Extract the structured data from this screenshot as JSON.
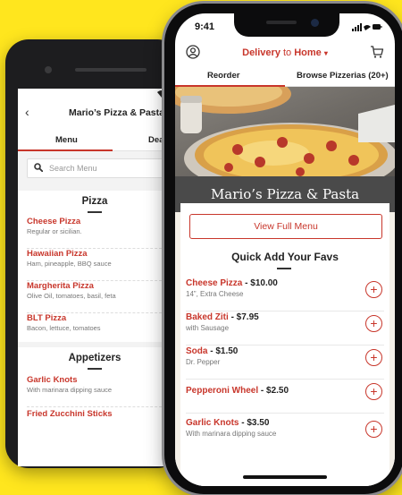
{
  "android": {
    "header": {
      "back_glyph": "‹",
      "title": "Mario’s Pizza & Pasta"
    },
    "tabs": [
      {
        "label": "Menu"
      },
      {
        "label": "Dea"
      }
    ],
    "search": {
      "placeholder": "Search Menu",
      "icon": "search-icon"
    },
    "sections": [
      {
        "title": "Pizza",
        "items": [
          {
            "name": "Cheese Pizza",
            "desc": "Regular or sicilian."
          },
          {
            "name": "Hawaiian Pizza",
            "desc": "Ham, pineapple, BBQ sauce"
          },
          {
            "name": "Margherita Pizza",
            "desc": "Olive Oil, tomatoes, basil, feta"
          },
          {
            "name": "BLT Pizza",
            "desc": "Bacon, lettuce, tomatoes"
          }
        ]
      },
      {
        "title": "Appetizers",
        "items": [
          {
            "name": "Garlic Knots",
            "desc": "With marinara dipping sauce"
          },
          {
            "name": "Fried Zucchini Sticks",
            "desc": ""
          }
        ]
      }
    ]
  },
  "iphone": {
    "status": {
      "time": "9:41"
    },
    "header": {
      "delivery_label": "Delivery",
      "to_label": " to ",
      "destination": "Home",
      "caret": "▾"
    },
    "tabs": [
      {
        "label": "Reorder"
      },
      {
        "label": "Browse Pizzerias (20+)"
      }
    ],
    "hero": {
      "restaurant_name": "Mario’s Pizza & Pasta"
    },
    "full_menu_label": "View Full Menu",
    "quick_add": {
      "title": "Quick Add Your Favs",
      "add_glyph": "+",
      "items": [
        {
          "name": "Cheese Pizza",
          "price": " - $10.00",
          "desc": "14”, Extra Cheese"
        },
        {
          "name": "Baked Ziti",
          "price": " - $7.95",
          "desc": "with Sausage"
        },
        {
          "name": "Soda",
          "price": " - $1.50",
          "desc": "Dr. Pepper"
        },
        {
          "name": "Pepperoni Wheel",
          "price": " - $2.50",
          "desc": ""
        },
        {
          "name": "Garlic Knots",
          "price": " - $3.50",
          "desc": "With marinara dipping sauce"
        }
      ]
    }
  },
  "colors": {
    "background": "#FFE61E",
    "accent": "#C8362B"
  }
}
